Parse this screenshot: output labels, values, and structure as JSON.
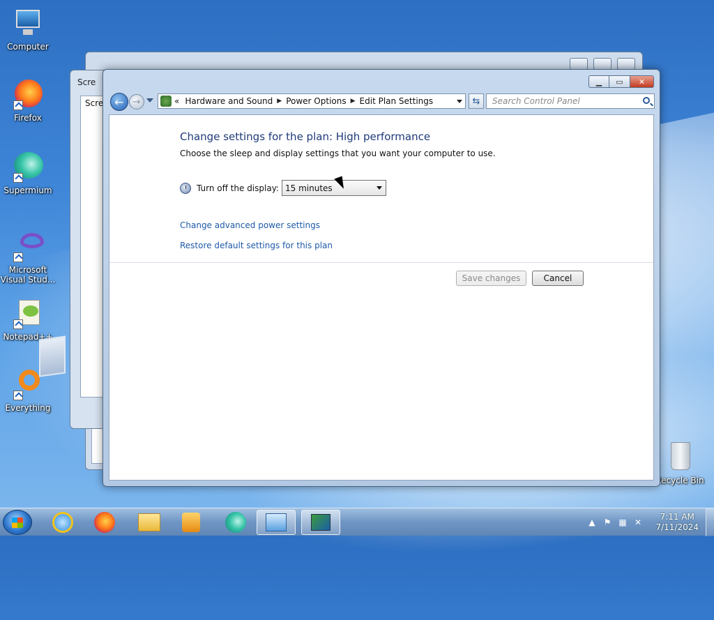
{
  "desktop": {
    "icons": [
      {
        "label": "Computer"
      },
      {
        "label": "Firefox"
      },
      {
        "label": "Supermium"
      },
      {
        "label": "Microsoft Visual Stud..."
      },
      {
        "label": "Notepad++"
      },
      {
        "label": "Everything"
      },
      {
        "label": "Recycle Bin"
      }
    ]
  },
  "background_window": {
    "title_fragment": "Scre",
    "inner_fragment": "Scree"
  },
  "window": {
    "breadcrumb": {
      "prefix": "«",
      "items": [
        "Hardware and Sound",
        "Power Options",
        "Edit Plan Settings"
      ]
    },
    "search": {
      "placeholder": "Search Control Panel"
    },
    "heading": "Change settings for the plan: High performance",
    "subtext": "Choose the sleep and display settings that you want your computer to use.",
    "display_setting": {
      "label": "Turn off the display:",
      "value": "15 minutes"
    },
    "links": {
      "advanced": "Change advanced power settings",
      "restore": "Restore default settings for this plan"
    },
    "buttons": {
      "save": "Save changes",
      "cancel": "Cancel"
    }
  },
  "taskbar": {
    "clock_time": "7:11 AM",
    "clock_date": "7/11/2024"
  },
  "colors": {
    "heading": "#1e3a78",
    "link": "#1e5aa8"
  }
}
